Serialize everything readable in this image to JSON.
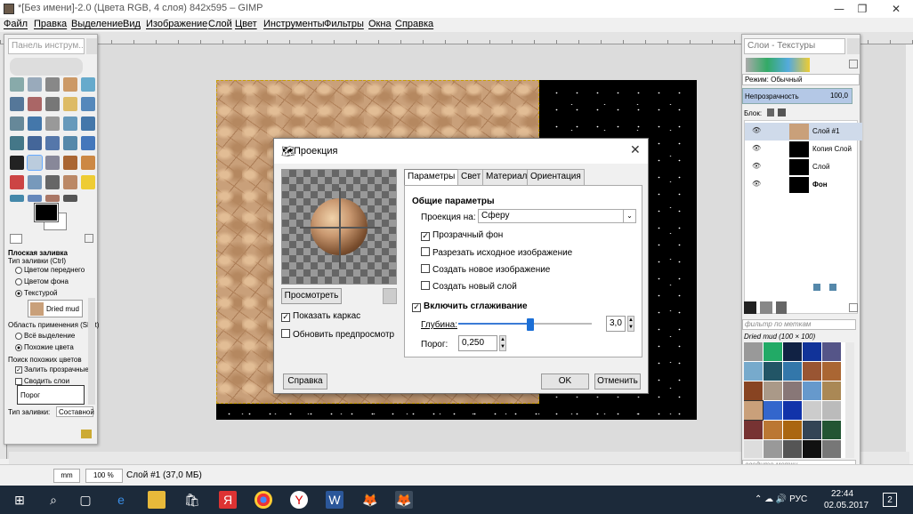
{
  "window": {
    "title": "*[Без имени]-2.0 (Цвета RGB, 4 слоя) 842x595 – GIMP"
  },
  "menu": [
    "Файл",
    "Правка",
    "Выделение",
    "Вид",
    "Изображение",
    "Слой",
    "Цвет",
    "Инструменты",
    "Фильтры",
    "Окна",
    "Справка"
  ],
  "toolbox": {
    "title": "Панель инструм...",
    "tool_name": "Плоская заливка",
    "fill_type_label": "Тип заливки (Ctrl)",
    "fill_fg": "Цветом переднего",
    "fill_bg": "Цветом фона",
    "fill_pattern": "Текстурой",
    "pattern_name": "Dried mud",
    "area_label": "Область применения (Shift)",
    "area_all": "Всё выделение",
    "area_similar": "Похожие цвета",
    "similar_label": "Поиск похожих цветов",
    "fill_transparent": "Залить прозрачные",
    "merge_layers": "Сводить слои",
    "threshold_label": "Порог",
    "fill_type_sel_label": "Тип заливки:",
    "fill_type_sel_value": "Составной"
  },
  "layers_panel": {
    "title": "Слои - Текстуры",
    "mode_label": "Режим: Обычный",
    "opacity_label": "Непрозрачность",
    "opacity_value": "100,0",
    "lock_label": "Блок:",
    "layers": [
      {
        "name": "Слой #1",
        "thumb": "#c9a07a",
        "bold": false
      },
      {
        "name": "Копия Слой",
        "thumb": "#000000",
        "bold": false
      },
      {
        "name": "Слой",
        "thumb": "#000000",
        "bold": false
      },
      {
        "name": "Фон",
        "thumb": "#000000",
        "bold": true
      }
    ],
    "pattern_filter": "фильтр по меткам",
    "pattern_current": "Dried mud (100 × 100)",
    "tag_input": "введите метки"
  },
  "status": {
    "unit": "mm",
    "zoom": "100 %",
    "text": "Слой #1 (37,0 МБ)"
  },
  "dialog": {
    "title": "Проекция",
    "preview_button": "Просмотреть",
    "show_wireframe": "Показать каркас",
    "auto_update": "Обновить предпросмотр",
    "tabs": [
      "Параметры",
      "Свет",
      "Материал",
      "Ориентация"
    ],
    "section_general": "Общие параметры",
    "map_to_label": "Проекция на:",
    "map_to_value": "Сферу",
    "transparent_bg": "Прозрачный фон",
    "tile_source": "Разрезать исходное изображение",
    "create_image": "Создать новое изображение",
    "create_layer": "Создать новый слой",
    "antialias": "Включить сглаживание",
    "depth_label": "Глубина:",
    "depth_value": "3,0",
    "threshold_label": "Порог:",
    "threshold_value": "0,250",
    "help_button": "Справка",
    "ok_button": "OK",
    "cancel_button": "Отменить"
  },
  "taskbar": {
    "lang": "РУС",
    "time": "22:44",
    "date": "02.05.2017",
    "notif_count": "2"
  }
}
